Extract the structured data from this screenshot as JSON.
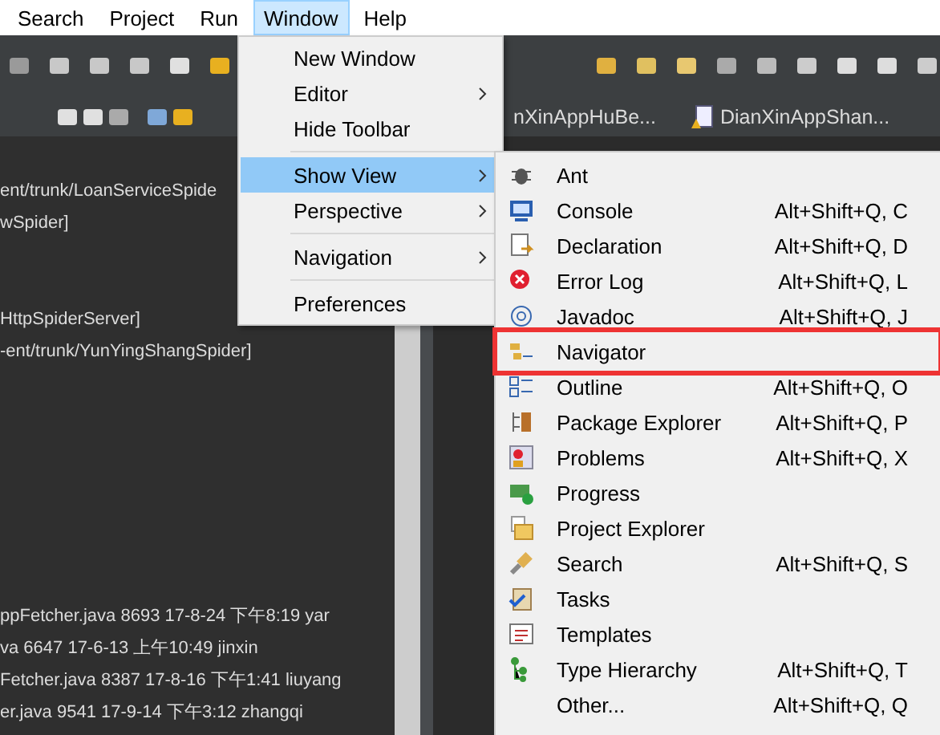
{
  "menubar": [
    {
      "label": "Search",
      "selected": false
    },
    {
      "label": "Project",
      "selected": false
    },
    {
      "label": "Run",
      "selected": false
    },
    {
      "label": "Window",
      "selected": true
    },
    {
      "label": "Help",
      "selected": false
    }
  ],
  "window_menu": {
    "groups": [
      [
        {
          "label": "New Window",
          "submenu": false,
          "selected": false
        },
        {
          "label": "Editor",
          "submenu": true,
          "selected": false
        },
        {
          "label": "Hide Toolbar",
          "submenu": false,
          "selected": false
        }
      ],
      [
        {
          "label": "Show View",
          "submenu": true,
          "selected": true
        },
        {
          "label": "Perspective",
          "submenu": true,
          "selected": false
        }
      ],
      [
        {
          "label": "Navigation",
          "submenu": true,
          "selected": false
        }
      ],
      [
        {
          "label": "Preferences",
          "submenu": false,
          "selected": false
        }
      ]
    ]
  },
  "show_view_menu": {
    "items": [
      {
        "label": "Ant",
        "highlighted": false
      },
      {
        "label": "Console",
        "shortcut": "Alt+Shift+Q, C",
        "highlighted": false
      },
      {
        "label": "Declaration",
        "shortcut": "Alt+Shift+Q, D",
        "highlighted": false
      },
      {
        "label": "Error Log",
        "shortcut": "Alt+Shift+Q, L",
        "highlighted": false
      },
      {
        "label": "Javadoc",
        "shortcut": "Alt+Shift+Q, J",
        "highlighted": false
      },
      {
        "label": "Navigator",
        "highlighted": true
      },
      {
        "label": "Outline",
        "shortcut": "Alt+Shift+Q, O",
        "highlighted": false
      },
      {
        "label": "Package Explorer",
        "shortcut": "Alt+Shift+Q, P",
        "highlighted": false
      },
      {
        "label": "Problems",
        "shortcut": "Alt+Shift+Q, X",
        "highlighted": false
      },
      {
        "label": "Progress",
        "highlighted": false
      },
      {
        "label": "Project Explorer",
        "highlighted": false
      },
      {
        "label": "Search",
        "shortcut": "Alt+Shift+Q, S",
        "highlighted": false
      },
      {
        "label": "Tasks",
        "highlighted": false
      },
      {
        "label": "Templates",
        "highlighted": false
      },
      {
        "label": "Type Hierarchy",
        "shortcut": "Alt+Shift+Q, T",
        "highlighted": false
      },
      {
        "label": "Other...",
        "shortcut": "Alt+Shift+Q, Q",
        "highlighted": false
      }
    ]
  },
  "editor_tabs": [
    {
      "label": "nXinAppHuBe..."
    },
    {
      "label": "DianXinAppShan..."
    }
  ],
  "console_top": [
    [
      "ent/trunk/LoanServiceSpide",
      "wSpider]"
    ],
    [
      "HttpSpiderServer]",
      "-ent/trunk/YunYingShangSpider]"
    ]
  ],
  "console_bottom": [
    "ppFetcher.java 8693  17-8-24 下午8:19  yar",
    "va 6647  17-6-13 上午10:49  jinxin",
    "Fetcher.java 8387  17-8-16 下午1:41  liuyang",
    "er.java 9541  17-9-14 下午3:12  zhangqi"
  ]
}
